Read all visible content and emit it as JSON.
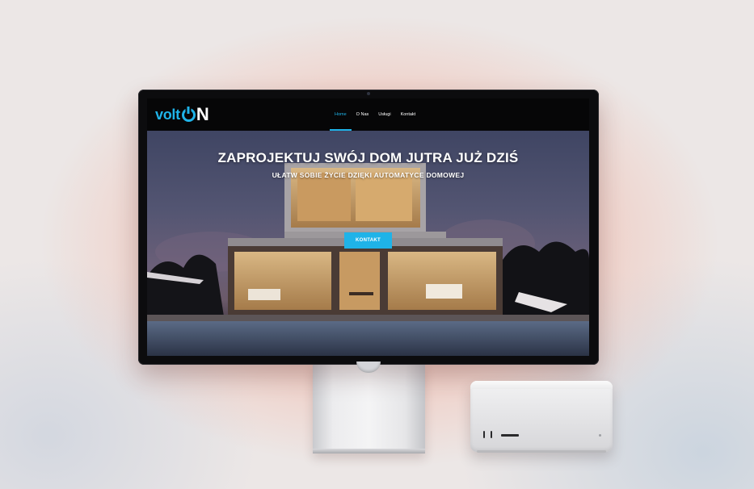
{
  "site": {
    "logo": {
      "volt": "volt",
      "on_suffix": "N"
    },
    "nav": [
      {
        "label": "Home",
        "active": true
      },
      {
        "label": "O Nas",
        "active": false
      },
      {
        "label": "Usługi",
        "active": false
      },
      {
        "label": "Kontakt",
        "active": false
      }
    ],
    "hero": {
      "title": "ZAPROJEKTUJ SWÓJ DOM JUTRA JUŻ DZIŚ",
      "subtitle": "UŁATW SOBIE ŻYCIE DZIĘKI AUTOMATYCE DOMOWEJ",
      "cta_label": "KONTAKT"
    }
  },
  "colors": {
    "accent": "#1fb3e8",
    "nav_background": "#060607",
    "page_background": "#ece7e6"
  },
  "icons": {
    "logo_power": "power-icon"
  }
}
